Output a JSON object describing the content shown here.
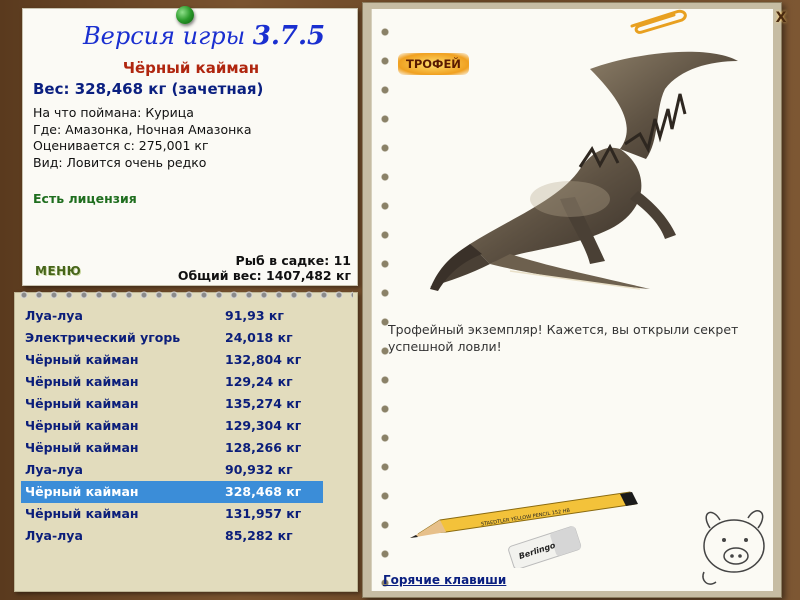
{
  "header": {
    "version_prefix": "Версия игры",
    "version_number": "3.7.5"
  },
  "fish": {
    "name": "Чёрный кайман",
    "weight_line": "Вес: 328,468 кг (зачетная)",
    "caught_on": "На что поймана: Курица",
    "location": "Где: Амазонка, Ночная Амазонка",
    "value": "Оценивается с: 275,001 кг",
    "rarity": "Вид: Ловится очень редко",
    "license": "Есть лицензия"
  },
  "menu": {
    "label": "МЕНЮ"
  },
  "stats": {
    "count": "Рыб в садке: 11",
    "total": "Общий вес: 1407,482 кг"
  },
  "catch_list": [
    {
      "name": "Луа-луа",
      "weight": "91,93 кг",
      "selected": false
    },
    {
      "name": "Электрический угорь",
      "weight": "24,018 кг",
      "selected": false
    },
    {
      "name": "Чёрный кайман",
      "weight": "132,804 кг",
      "selected": false
    },
    {
      "name": "Чёрный кайман",
      "weight": "129,24 кг",
      "selected": false
    },
    {
      "name": "Чёрный кайман",
      "weight": "135,274 кг",
      "selected": false
    },
    {
      "name": "Чёрный кайман",
      "weight": "129,304 кг",
      "selected": false
    },
    {
      "name": "Чёрный кайман",
      "weight": "128,266 кг",
      "selected": false
    },
    {
      "name": "Луа-луа",
      "weight": "90,932 кг",
      "selected": false
    },
    {
      "name": "Чёрный кайман",
      "weight": "328,468 кг",
      "selected": true
    },
    {
      "name": "Чёрный кайман",
      "weight": "131,957 кг",
      "selected": false
    },
    {
      "name": "Луа-луа",
      "weight": "85,282 кг",
      "selected": false
    }
  ],
  "trophy": {
    "badge": "ТРОФЕЙ",
    "text": "Трофейный экземпляр! Кажется, вы открыли секрет успешной ловли!"
  },
  "footer": {
    "hotkeys": "Горячие клавиши"
  },
  "window": {
    "close_label": "X"
  },
  "decor": {
    "pencil_brand": "STAEDTLER YELLOW PENCIL 152 HB",
    "eraser_brand": "Berlingo"
  },
  "colors": {
    "version_blue": "#1a2fd0",
    "title_red": "#b0260f",
    "list_blue": "#0b1e7a",
    "selection": "#3b8dd8",
    "license_green": "#1f6e1f"
  }
}
